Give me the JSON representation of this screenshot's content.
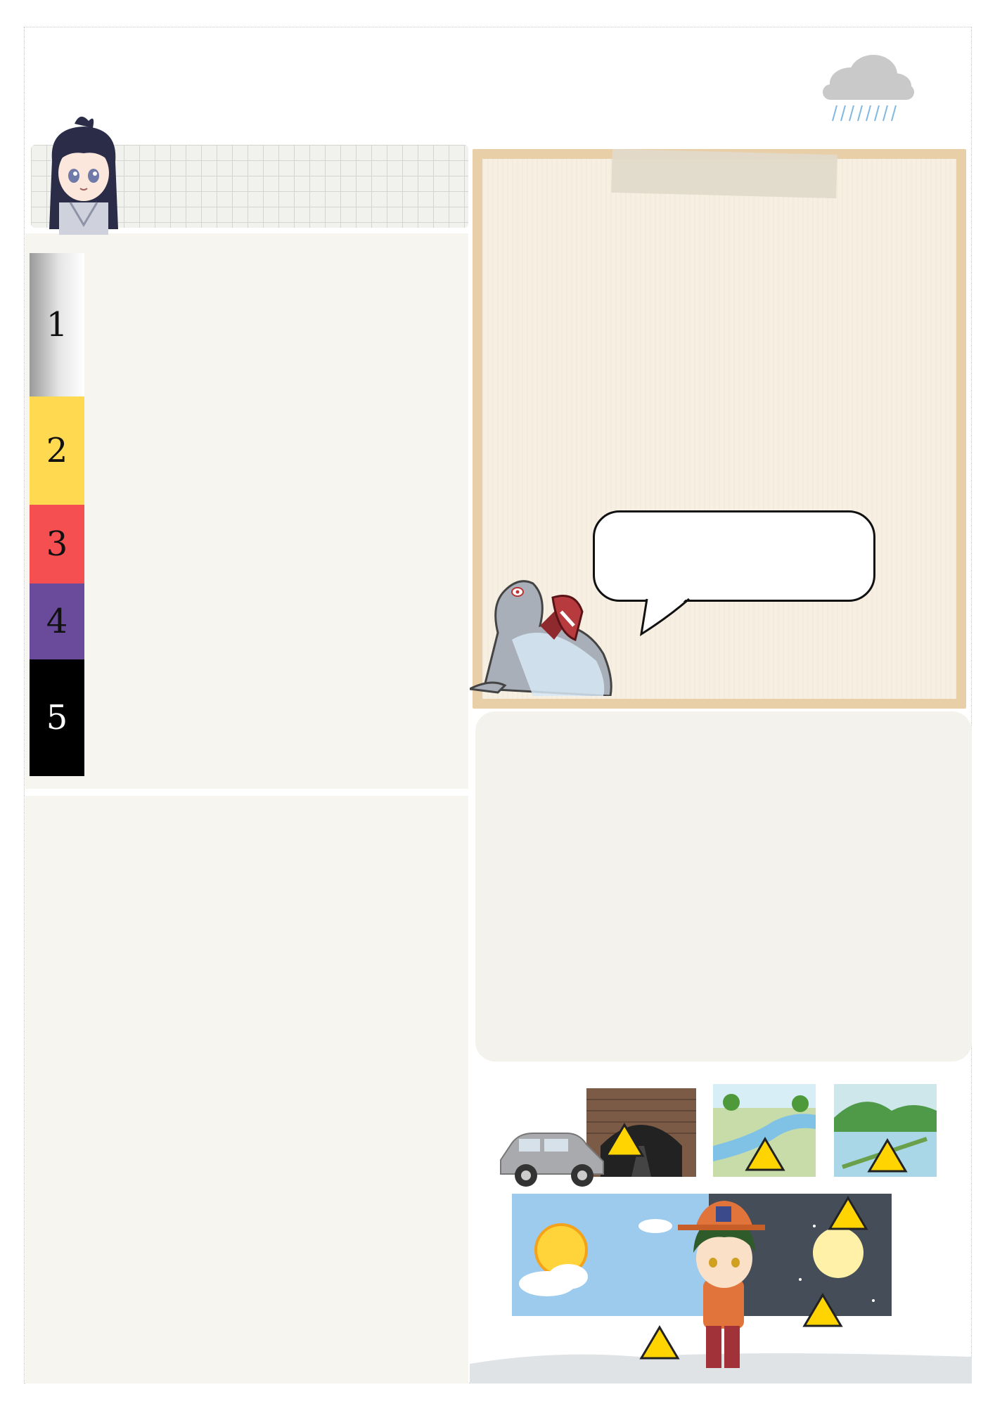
{
  "warning_scale": {
    "levels": [
      {
        "label": "1",
        "color": "#c4c4c4",
        "text_color": "#111111"
      },
      {
        "label": "2",
        "color": "#ffd94f",
        "text_color": "#111111"
      },
      {
        "label": "3",
        "color": "#f54f51",
        "text_color": "#111111"
      },
      {
        "label": "4",
        "color": "#6a4a9a",
        "text_color": "#111111"
      },
      {
        "label": "5",
        "color": "#000000",
        "text_color": "#ffffff"
      }
    ]
  },
  "icons": {
    "cloud": "rain-cloud-icon",
    "avatar": "girl-avatar",
    "seal": "seal-mascot",
    "warning": "warning-icon"
  },
  "colors": {
    "panel": "#f7f5f0",
    "board_frame": "#e9cfa8",
    "board_paper": "#f6efe2",
    "warning_yellow": "#ffd400"
  }
}
